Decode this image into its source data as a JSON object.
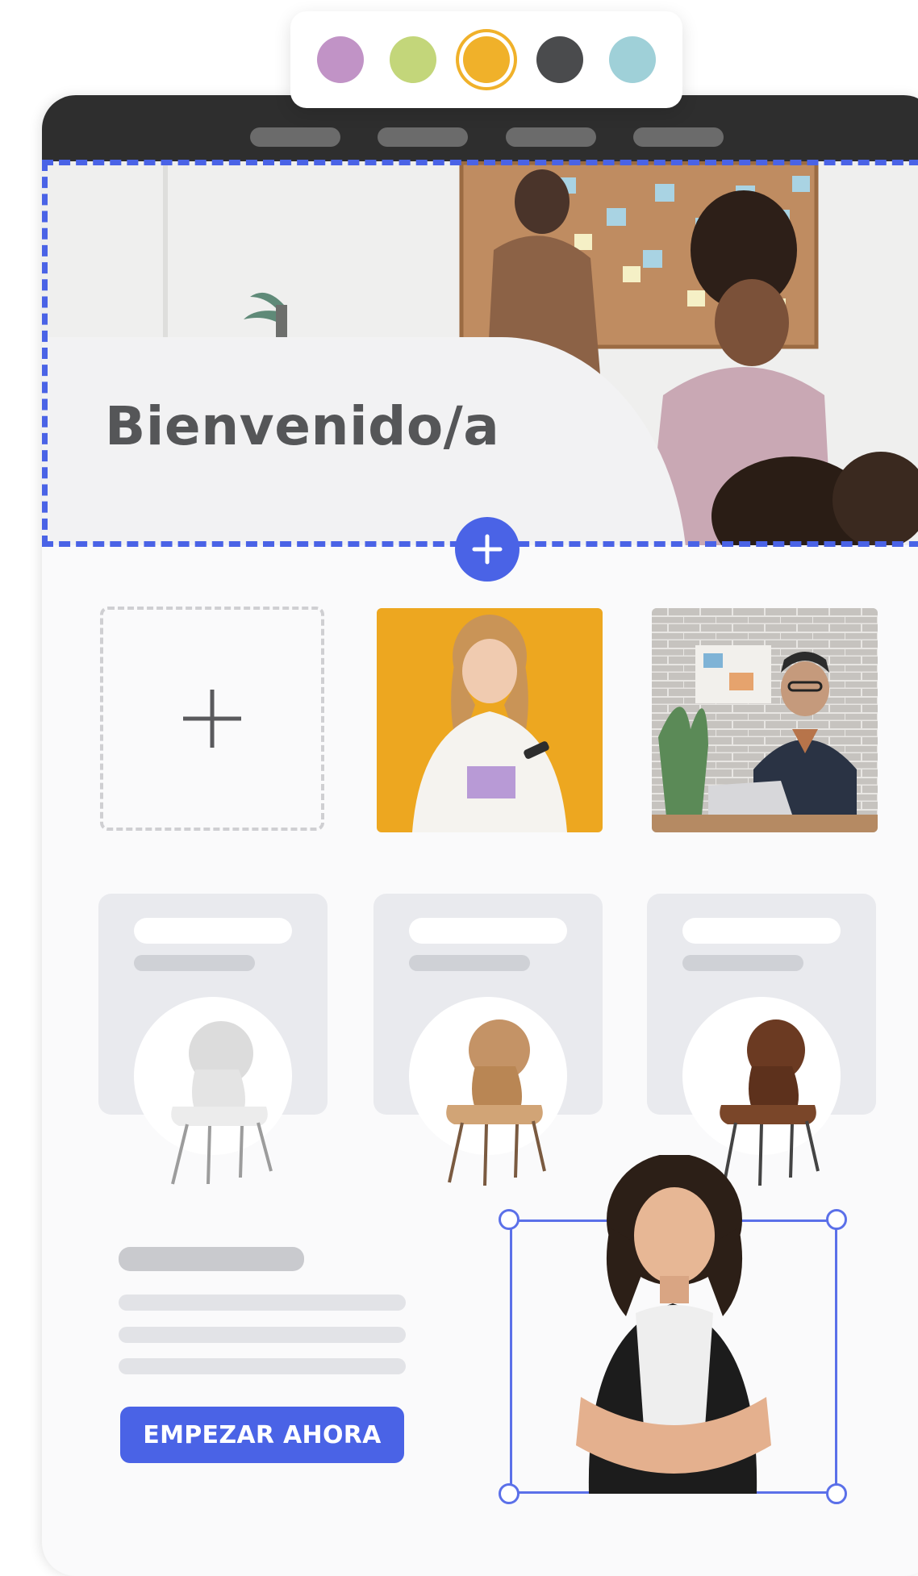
{
  "palette": {
    "colors": [
      "#c193c6",
      "#c3d67a",
      "#f0b12a",
      "#4a4b4d",
      "#9fd0d8"
    ],
    "selected_index": 2
  },
  "window": {
    "nav_items": 4
  },
  "hero": {
    "title": "Bienvenido/a"
  },
  "gallery": {
    "items": [
      {
        "name": "add-image-placeholder"
      },
      {
        "name": "woman-with-phone-photo",
        "background": "#eda720"
      },
      {
        "name": "man-with-laptop-photo"
      }
    ]
  },
  "products": [
    {
      "chair": "white-chair-icon",
      "color": "#e4e4e4"
    },
    {
      "chair": "wooden-chair-icon",
      "color": "#c08f5c"
    },
    {
      "chair": "walnut-chair-icon",
      "color": "#6b3a22"
    }
  ],
  "cta": {
    "label": "EMPEZAR AHORA"
  },
  "colors": {
    "accent": "#4a63e6",
    "topbar": "#2e2e2e"
  }
}
